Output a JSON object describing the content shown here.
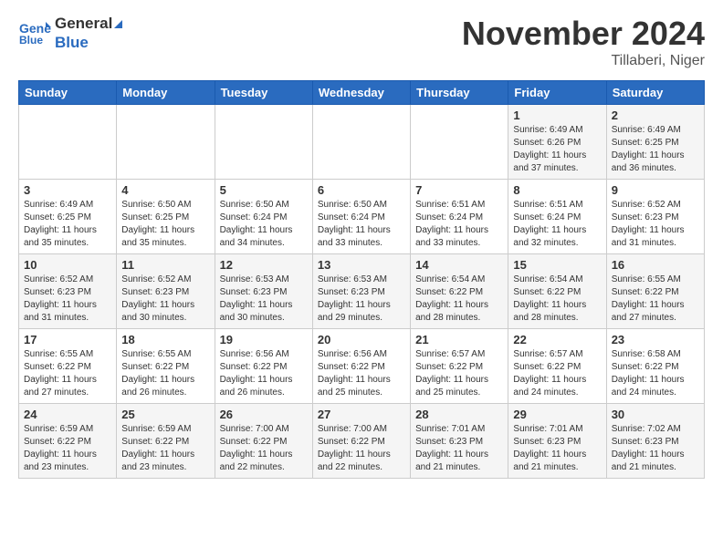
{
  "header": {
    "logo_line1": "General",
    "logo_line2": "Blue",
    "month": "November 2024",
    "location": "Tillaberi, Niger"
  },
  "weekdays": [
    "Sunday",
    "Monday",
    "Tuesday",
    "Wednesday",
    "Thursday",
    "Friday",
    "Saturday"
  ],
  "weeks": [
    [
      {
        "day": "",
        "detail": ""
      },
      {
        "day": "",
        "detail": ""
      },
      {
        "day": "",
        "detail": ""
      },
      {
        "day": "",
        "detail": ""
      },
      {
        "day": "",
        "detail": ""
      },
      {
        "day": "1",
        "detail": "Sunrise: 6:49 AM\nSunset: 6:26 PM\nDaylight: 11 hours\nand 37 minutes."
      },
      {
        "day": "2",
        "detail": "Sunrise: 6:49 AM\nSunset: 6:25 PM\nDaylight: 11 hours\nand 36 minutes."
      }
    ],
    [
      {
        "day": "3",
        "detail": "Sunrise: 6:49 AM\nSunset: 6:25 PM\nDaylight: 11 hours\nand 35 minutes."
      },
      {
        "day": "4",
        "detail": "Sunrise: 6:50 AM\nSunset: 6:25 PM\nDaylight: 11 hours\nand 35 minutes."
      },
      {
        "day": "5",
        "detail": "Sunrise: 6:50 AM\nSunset: 6:24 PM\nDaylight: 11 hours\nand 34 minutes."
      },
      {
        "day": "6",
        "detail": "Sunrise: 6:50 AM\nSunset: 6:24 PM\nDaylight: 11 hours\nand 33 minutes."
      },
      {
        "day": "7",
        "detail": "Sunrise: 6:51 AM\nSunset: 6:24 PM\nDaylight: 11 hours\nand 33 minutes."
      },
      {
        "day": "8",
        "detail": "Sunrise: 6:51 AM\nSunset: 6:24 PM\nDaylight: 11 hours\nand 32 minutes."
      },
      {
        "day": "9",
        "detail": "Sunrise: 6:52 AM\nSunset: 6:23 PM\nDaylight: 11 hours\nand 31 minutes."
      }
    ],
    [
      {
        "day": "10",
        "detail": "Sunrise: 6:52 AM\nSunset: 6:23 PM\nDaylight: 11 hours\nand 31 minutes."
      },
      {
        "day": "11",
        "detail": "Sunrise: 6:52 AM\nSunset: 6:23 PM\nDaylight: 11 hours\nand 30 minutes."
      },
      {
        "day": "12",
        "detail": "Sunrise: 6:53 AM\nSunset: 6:23 PM\nDaylight: 11 hours\nand 30 minutes."
      },
      {
        "day": "13",
        "detail": "Sunrise: 6:53 AM\nSunset: 6:23 PM\nDaylight: 11 hours\nand 29 minutes."
      },
      {
        "day": "14",
        "detail": "Sunrise: 6:54 AM\nSunset: 6:22 PM\nDaylight: 11 hours\nand 28 minutes."
      },
      {
        "day": "15",
        "detail": "Sunrise: 6:54 AM\nSunset: 6:22 PM\nDaylight: 11 hours\nand 28 minutes."
      },
      {
        "day": "16",
        "detail": "Sunrise: 6:55 AM\nSunset: 6:22 PM\nDaylight: 11 hours\nand 27 minutes."
      }
    ],
    [
      {
        "day": "17",
        "detail": "Sunrise: 6:55 AM\nSunset: 6:22 PM\nDaylight: 11 hours\nand 27 minutes."
      },
      {
        "day": "18",
        "detail": "Sunrise: 6:55 AM\nSunset: 6:22 PM\nDaylight: 11 hours\nand 26 minutes."
      },
      {
        "day": "19",
        "detail": "Sunrise: 6:56 AM\nSunset: 6:22 PM\nDaylight: 11 hours\nand 26 minutes."
      },
      {
        "day": "20",
        "detail": "Sunrise: 6:56 AM\nSunset: 6:22 PM\nDaylight: 11 hours\nand 25 minutes."
      },
      {
        "day": "21",
        "detail": "Sunrise: 6:57 AM\nSunset: 6:22 PM\nDaylight: 11 hours\nand 25 minutes."
      },
      {
        "day": "22",
        "detail": "Sunrise: 6:57 AM\nSunset: 6:22 PM\nDaylight: 11 hours\nand 24 minutes."
      },
      {
        "day": "23",
        "detail": "Sunrise: 6:58 AM\nSunset: 6:22 PM\nDaylight: 11 hours\nand 24 minutes."
      }
    ],
    [
      {
        "day": "24",
        "detail": "Sunrise: 6:59 AM\nSunset: 6:22 PM\nDaylight: 11 hours\nand 23 minutes."
      },
      {
        "day": "25",
        "detail": "Sunrise: 6:59 AM\nSunset: 6:22 PM\nDaylight: 11 hours\nand 23 minutes."
      },
      {
        "day": "26",
        "detail": "Sunrise: 7:00 AM\nSunset: 6:22 PM\nDaylight: 11 hours\nand 22 minutes."
      },
      {
        "day": "27",
        "detail": "Sunrise: 7:00 AM\nSunset: 6:22 PM\nDaylight: 11 hours\nand 22 minutes."
      },
      {
        "day": "28",
        "detail": "Sunrise: 7:01 AM\nSunset: 6:23 PM\nDaylight: 11 hours\nand 21 minutes."
      },
      {
        "day": "29",
        "detail": "Sunrise: 7:01 AM\nSunset: 6:23 PM\nDaylight: 11 hours\nand 21 minutes."
      },
      {
        "day": "30",
        "detail": "Sunrise: 7:02 AM\nSunset: 6:23 PM\nDaylight: 11 hours\nand 21 minutes."
      }
    ]
  ]
}
